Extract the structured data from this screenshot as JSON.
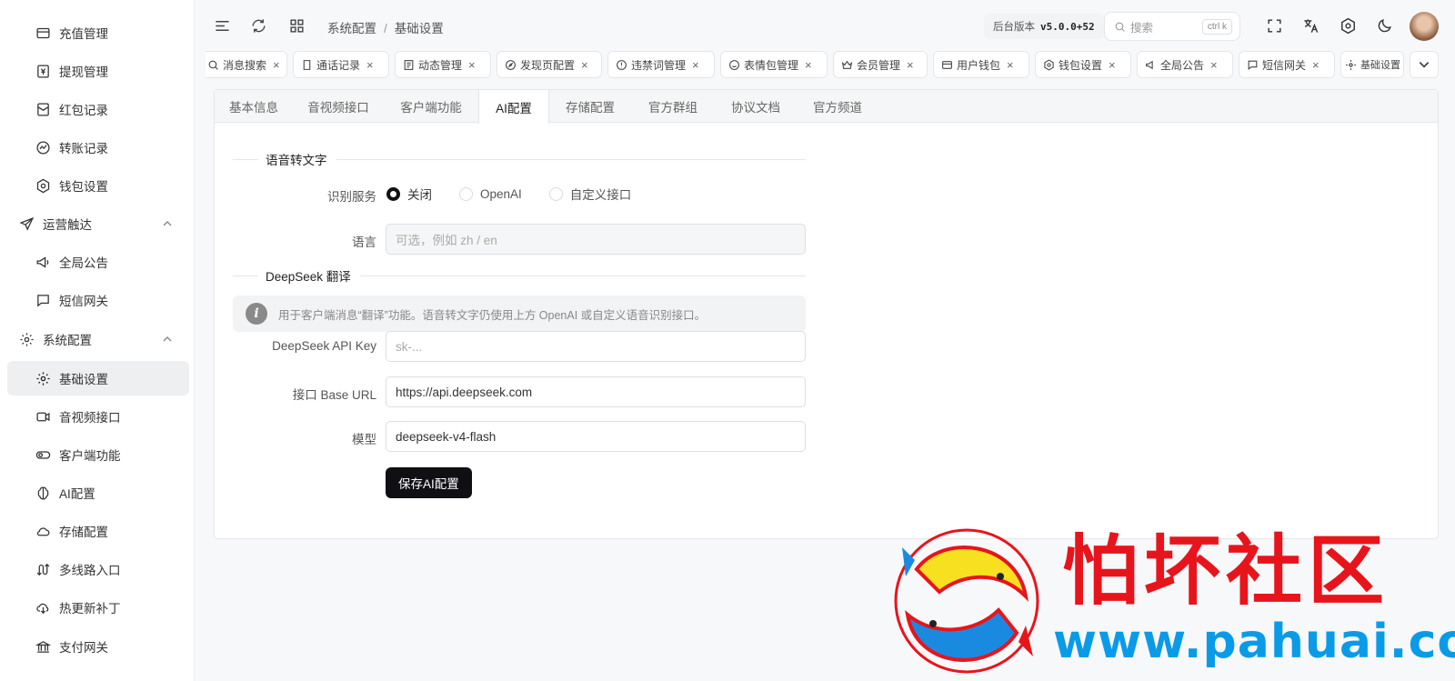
{
  "sidebar": {
    "items": [
      {
        "label": "充值管理",
        "icon": "wallet-icon"
      },
      {
        "label": "提现管理",
        "icon": "yen-icon"
      },
      {
        "label": "红包记录",
        "icon": "envelope-icon"
      },
      {
        "label": "转账记录",
        "icon": "chart-icon"
      },
      {
        "label": "钱包设置",
        "icon": "gear-icon"
      },
      {
        "label": "运营触达",
        "icon": "send-icon"
      },
      {
        "label": "全局公告",
        "icon": "megaphone-icon"
      },
      {
        "label": "短信网关",
        "icon": "message-icon"
      },
      {
        "label": "系统配置",
        "icon": "gear-icon"
      },
      {
        "label": "基础设置",
        "icon": "gear-icon"
      },
      {
        "label": "音视频接口",
        "icon": "video-icon"
      },
      {
        "label": "客户端功能",
        "icon": "toggle-icon"
      },
      {
        "label": "AI配置",
        "icon": "ai-icon"
      },
      {
        "label": "存储配置",
        "icon": "cloud-icon"
      },
      {
        "label": "多线路入口",
        "icon": "route-icon"
      },
      {
        "label": "热更新补丁",
        "icon": "cloud-download-icon"
      },
      {
        "label": "支付网关",
        "icon": "bank-icon"
      }
    ]
  },
  "header": {
    "breadcrumb": [
      "系统配置",
      "基础设置"
    ],
    "version_label": "后台版本",
    "version_value": "v5.0.0+52",
    "search_placeholder": "搜索",
    "search_shortcut": "ctrl k"
  },
  "page_tabs": [
    {
      "label": "消息搜索",
      "icon": "search-icon"
    },
    {
      "label": "通话记录",
      "icon": "phone-icon"
    },
    {
      "label": "动态管理",
      "icon": "list-icon"
    },
    {
      "label": "发现页配置",
      "icon": "compass-icon"
    },
    {
      "label": "违禁词管理",
      "icon": "warning-icon"
    },
    {
      "label": "表情包管理",
      "icon": "smile-icon"
    },
    {
      "label": "会员管理",
      "icon": "crown-icon"
    },
    {
      "label": "用户钱包",
      "icon": "wallet-icon"
    },
    {
      "label": "钱包设置",
      "icon": "gear-icon"
    },
    {
      "label": "全局公告",
      "icon": "megaphone-icon"
    },
    {
      "label": "短信网关",
      "icon": "message-icon"
    },
    {
      "label": "基础设置",
      "icon": "gear-icon"
    }
  ],
  "content_tabs": [
    "基本信息",
    "音视频接口",
    "客户端功能",
    "AI配置",
    "存储配置",
    "官方群组",
    "协议文档",
    "官方频道"
  ],
  "active_content_tab": "AI配置",
  "form": {
    "section_speech": "语音转文字",
    "service_label": "识别服务",
    "service_options": [
      "关闭",
      "OpenAI",
      "自定义接口"
    ],
    "service_selected": "关闭",
    "language_label": "语言",
    "language_placeholder": "可选，例如 zh / en",
    "section_deepseek": "DeepSeek 翻译",
    "alert_text": "用于客户端消息“翻译”功能。语音转文字仍使用上方 OpenAI 或自定义语音识别接口。",
    "api_key_label": "DeepSeek API Key",
    "api_key_placeholder": "sk-...",
    "base_url_label": "接口 Base URL",
    "base_url_value": "https://api.deepseek.com",
    "model_label": "模型",
    "model_value": "deepseek-v4-flash",
    "save_label": "保存AI配置"
  },
  "watermark": {
    "title": "怕坏社区",
    "url": "www.pahuai.com"
  },
  "colors": {
    "primary_button": "#0f0f14",
    "watermark_red": "#e8141c",
    "watermark_blue": "#0a9be8"
  }
}
